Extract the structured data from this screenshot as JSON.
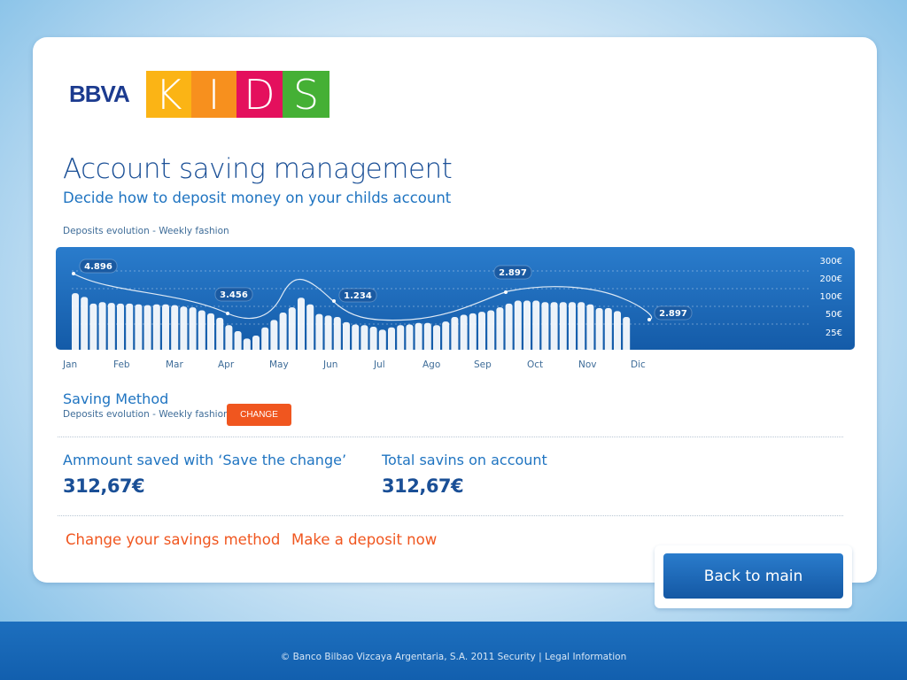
{
  "brand": {
    "bank": "BBVA",
    "kids_letters": [
      {
        "char": "K",
        "color": "#fbb415"
      },
      {
        "char": "I",
        "color": "#f7901e"
      },
      {
        "char": "D",
        "color": "#e4105d"
      },
      {
        "char": "S",
        "color": "#45b035"
      }
    ]
  },
  "header": {
    "title": "Account saving management",
    "subtitle": "Decide how to deposit money on your childs account"
  },
  "chart_caption": "Deposits evolution - Weekly fashion",
  "chart_data": {
    "type": "bar",
    "title": "Deposits evolution - Weekly fashion",
    "months": [
      "Jan",
      "Feb",
      "Mar",
      "Apr",
      "May",
      "Jun",
      "Jul",
      "Ago",
      "Sep",
      "Oct",
      "Nov",
      "Dic"
    ],
    "y_ticks": [
      "300€",
      "200€",
      "100€",
      "50€",
      "25€"
    ],
    "values": [
      76,
      71,
      62,
      64,
      63,
      62,
      62,
      61,
      60,
      61,
      61,
      60,
      58,
      57,
      53,
      49,
      43,
      33,
      25,
      15,
      19,
      30,
      40,
      50,
      57,
      70,
      61,
      48,
      46,
      44,
      37,
      34,
      33,
      31,
      27,
      30,
      33,
      34,
      36,
      36,
      33,
      38,
      44,
      47,
      49,
      51,
      53,
      57,
      62,
      66,
      66,
      66,
      64,
      64,
      64,
      64,
      64,
      61,
      56,
      56,
      52,
      44
    ],
    "value_unit": "relative height (0-100)",
    "annotations": [
      "4.896",
      "3.456",
      "1.234",
      "2.897",
      "2.897"
    ],
    "bar_color": "#ffffff",
    "background": "#1e6ab8"
  },
  "saving_method": {
    "title": "Saving Method",
    "value": "Deposits evolution - Weekly fashion",
    "change_label": "CHANGE"
  },
  "stats": {
    "saved_label": "Ammount saved with ‘Save the change’",
    "saved_value": "312,67€",
    "total_label": "Total savins on account",
    "total_value": "312,67€"
  },
  "links": {
    "change_method": "Change your savings method",
    "deposit": "Make a deposit now"
  },
  "back_label": "Back to main",
  "footer": "© Banco Bilbao Vizcaya Argentaria, S.A. 2011 Security | Legal Information",
  "colors": {
    "accent": "#f0561f",
    "primary": "#1f74c1",
    "dark_blue": "#1a4f96"
  }
}
